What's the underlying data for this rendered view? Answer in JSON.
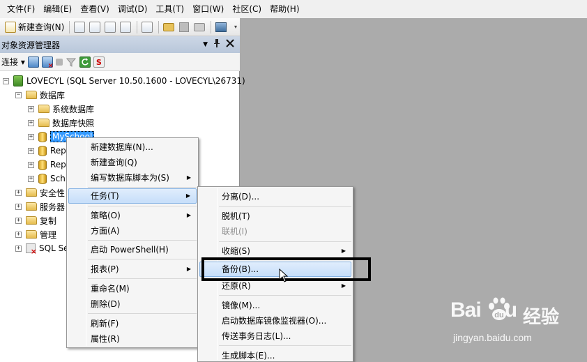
{
  "menubar": {
    "items": [
      "文件(F)",
      "编辑(E)",
      "查看(V)",
      "调试(D)",
      "工具(T)",
      "窗口(W)",
      "社区(C)",
      "帮助(H)"
    ]
  },
  "toolbar": {
    "new_query_label": "新建查询(N)"
  },
  "object_explorer": {
    "title": "对象资源管理器",
    "connect_label": "连接",
    "tree": {
      "server": "LOVECYL (SQL Server 10.50.1600 - LOVECYL\\26731)",
      "databases": "数据库",
      "system_databases": "系统数据库",
      "database_snapshots": "数据库快照",
      "selected_db": "MySchool",
      "db2": "Rep",
      "db3": "Rep",
      "db4": "Sch",
      "security": "安全性",
      "server_objects": "服务器",
      "replication": "复制",
      "management": "管理",
      "sql_agent": "SQL Se"
    }
  },
  "context_menu": {
    "items": {
      "new_database": "新建数据库(N)...",
      "new_query": "新建查询(Q)",
      "script_database_as": "编写数据库脚本为(S)",
      "tasks": "任务(T)",
      "policies": "策略(O)",
      "facets": "方面(A)",
      "start_powershell": "启动 PowerShell(H)",
      "reports": "报表(P)",
      "rename": "重命名(M)",
      "delete": "删除(D)",
      "refresh": "刷新(F)",
      "properties": "属性(R)"
    }
  },
  "tasks_submenu": {
    "items": {
      "detach": "分离(D)...",
      "take_offline": "脱机(T)",
      "bring_online": "联机(I)",
      "shrink": "收缩(S)",
      "backup": "备份(B)...",
      "restore": "还原(R)",
      "mirror": "镜像(M)...",
      "launch_mirror_monitor": "启动数据库镜像监视器(O)...",
      "ship_logs": "传送事务日志(L)...",
      "generate_scripts": "生成脚本(E)..."
    }
  },
  "watermark": {
    "logo": "Bai",
    "logo_tail": "u",
    "brand_cn": "经验",
    "url": "jingyan.baidu.com"
  }
}
